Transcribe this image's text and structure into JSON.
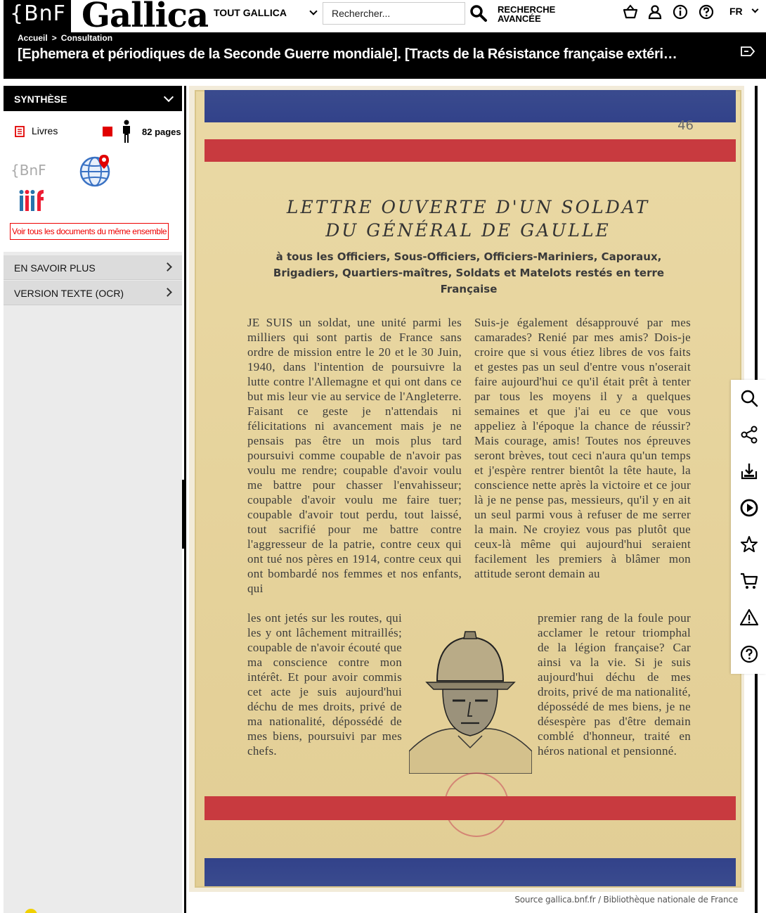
{
  "header": {
    "bnf_logo": "{BnF",
    "gallica_logo": "Gallica",
    "scope": "TOUT GALLICA",
    "search_placeholder": "Rechercher...",
    "advanced_search_line1": "RECHERCHE",
    "advanced_search_line2": "AVANCÉE",
    "language": "FR",
    "icons": [
      "basket-icon",
      "user-icon",
      "info-icon",
      "help-icon"
    ]
  },
  "breadcrumb": [
    "Accueil",
    ">",
    "Consultation"
  ],
  "document_title": "[Ephemera et périodiques de la Seconde Guerre mondiale]. [Tracts de la Résistance française extéri…",
  "left_panel": {
    "synthese_label": "SYNTHÈSE",
    "type_label": "Livres",
    "pages_label": "82 pages",
    "bnf_small": "{BnF",
    "same_set_link": "Voir tous les documents du même ensemble",
    "en_savoir_plus": "EN SAVOIR PLUS",
    "version_texte": "VERSION TEXTE (OCR)"
  },
  "page": {
    "pencil_mark": "46",
    "heading_line1": "LETTRE OUVERTE D'UN SOLDAT",
    "heading_line2": "DU GÉNÉRAL DE GAULLE",
    "subheading": "à tous les Officiers, Sous-Officiers, Officiers-Mariniers, Caporaux, Brigadiers, Quartiers-maîtres, Soldats et Matelots restés en terre Française",
    "col_left": "JE SUIS un soldat, une unité parmi les milliers qui sont partis de France sans ordre de mission entre le 20 et le 30 Juin, 1940, dans l'intention de poursuivre la lutte contre l'Allemagne et qui ont dans ce but mis leur vie au service de l'Angleterre. Faisant ce geste je n'attendais ni félicitations ni avancement mais je ne pensais pas être un mois plus tard poursuivi comme coupable de n'avoir pas voulu me rendre; coupable d'avoir voulu me battre pour chasser l'envahisseur; coupable d'avoir voulu me faire tuer; coupable d'avoir tout perdu, tout laissé, tout sacrifié pour me battre contre l'aggresseur de la patrie, contre ceux qui ont tué nos pères en 1914, contre ceux qui ont bombardé nos femmes et nos enfants, qui",
    "col_left2": "les ont jetés sur les routes, qui les y ont lâchement mitraillés; coupable de n'avoir écouté que ma conscience contre mon intérêt. Et pour avoir commis cet acte je suis aujourd'hui déchu de mes droits, privé de ma nationalité, dépossédé de mes biens, poursuivi par mes chefs.",
    "col_right": "Suis-je également désapprouvé par mes camarades? Renié par mes amis? Dois-je croire que si vous étiez libres de vos faits et gestes pas un seul d'entre vous n'oserait faire aujourd'hui ce qu'il était prêt à tenter par tous les moyens il y a quelques semaines et que j'ai eu ce que vous appeliez à l'époque la chance de réussir? Mais courage, amis! Toutes nos épreuves seront brèves, tout ceci n'aura qu'un temps et j'espère rentrer bientôt la tête haute, la conscience nette après la victoire et ce jour là je ne pense pas, messieurs, qu'il y en ait un seul parmi vous à refuser de me serrer la main. Ne croyiez vous pas plutôt que ceux-là même qui aujourd'hui seraient facilement les premiers à blâmer mon attitude seront demain au",
    "col_right2": "premier rang de la foule pour acclamer le retour triomphal de la légion française? Car ainsi va la vie. Si je suis aujourd'hui déchu de mes droits, privé de ma nationalité, dépossédé de mes biens, je ne désespère pas d'être demain comblé d'honneur, traité en héros national et pensionné."
  },
  "source_caption": "Source gallica.bnf.fr / Bibliothèque nationale de France",
  "right_tools": [
    "search-icon",
    "share-icon",
    "download-icon",
    "play-icon",
    "star-icon",
    "cart-icon",
    "warning-icon",
    "help-icon"
  ],
  "colors": {
    "accent_red": "#e10000",
    "stripe_blue": "#2f3f86",
    "stripe_red": "#c8303a",
    "paper": "#e6d39c"
  }
}
